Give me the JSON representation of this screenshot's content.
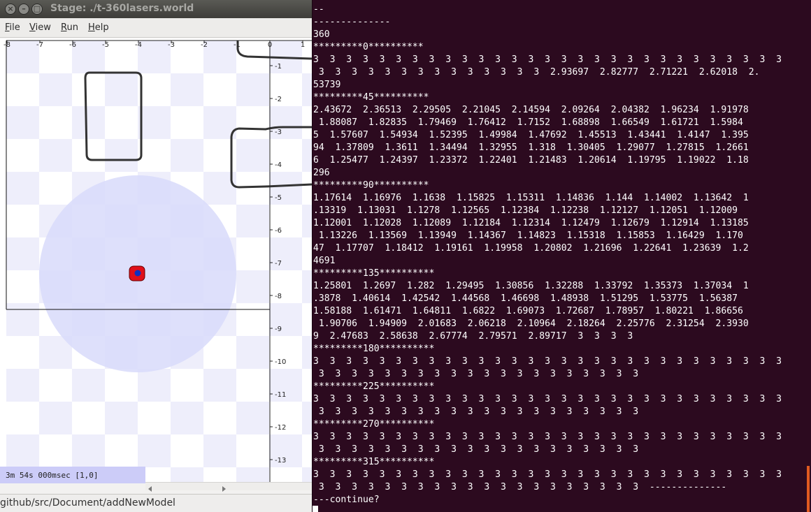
{
  "window": {
    "title": "Stage: ./t-360lasers.world",
    "close_glyph": "×",
    "minimize_glyph": "–",
    "maximize_glyph": "□"
  },
  "menu": [
    {
      "label": "File",
      "mnemonic": "F",
      "rest": "ile"
    },
    {
      "label": "View",
      "mnemonic": "V",
      "rest": "iew"
    },
    {
      "label": "Run",
      "mnemonic": "R",
      "rest": "un"
    },
    {
      "label": "Help",
      "mnemonic": "H",
      "rest": "elp"
    }
  ],
  "canvas": {
    "x_ticks": [
      "-8",
      "-7",
      "-6",
      "-5",
      "-4",
      "-3",
      "-2",
      "-1",
      "0",
      "1"
    ],
    "y_ticks": [
      "-1",
      "-2",
      "-3",
      "-4",
      "-5",
      "-6",
      "-7",
      "-8",
      "-9",
      "-10",
      "-11",
      "-12",
      "-13"
    ],
    "robot_color": "#e0101a",
    "robot_center_color": "#1030c0",
    "laser_range_color": "#d8dafa"
  },
  "status": {
    "text": "3m 54s 000msec [1,0]"
  },
  "nautilus": {
    "path": "github/src/Document/addNewModel"
  },
  "terminal": {
    "lines": [
      "--",
      "--------------",
      "360",
      "*********0**********",
      "3  3  3  3  3  3  3  3  3  3  3  3  3  3  3  3  3  3  3  3  3  3  3  3  3  3  3  3  3",
      " 3  3  3  3  3  3  3  3  3  3  3  3  3  3  2.93697  2.82777  2.71221  2.62018  2.",
      "53739",
      "*********45**********",
      "2.43672  2.36513  2.29505  2.21045  2.14594  2.09264  2.04382  1.96234  1.91978",
      " 1.88087  1.82835  1.79469  1.76412  1.7152  1.68898  1.66549  1.61721  1.5984",
      "5  1.57607  1.54934  1.52395  1.49984  1.47692  1.45513  1.43441  1.4147  1.395",
      "94  1.37809  1.3611  1.34494  1.32955  1.318  1.30405  1.29077  1.27815  1.2661",
      "6  1.25477  1.24397  1.23372  1.22401  1.21483  1.20614  1.19795  1.19022  1.18",
      "296",
      "*********90**********",
      "1.17614  1.16976  1.1638  1.15825  1.15311  1.14836  1.144  1.14002  1.13642  1",
      ".13319  1.13031  1.1278  1.12565  1.12384  1.12238  1.12127  1.12051  1.12009",
      "1.12001  1.12028  1.12089  1.12184  1.12314  1.12479  1.12679  1.12914  1.13185",
      " 1.13226  1.13569  1.13949  1.14367  1.14823  1.15318  1.15853  1.16429  1.170",
      "47  1.17707  1.18412  1.19161  1.19958  1.20802  1.21696  1.22641  1.23639  1.2",
      "4691",
      "*********135**********",
      "1.25801  1.2697  1.282  1.29495  1.30856  1.32288  1.33792  1.35373  1.37034  1",
      ".3878  1.40614  1.42542  1.44568  1.46698  1.48938  1.51295  1.53775  1.56387",
      "1.58188  1.61471  1.64811  1.6822  1.69073  1.72687  1.78957  1.80221  1.86656",
      " 1.90706  1.94909  2.01683  2.06218  2.10964  2.18264  2.25776  2.31254  2.3930",
      "9  2.47683  2.58638  2.67774  2.79571  2.89717  3  3  3  3",
      "*********180**********",
      "3  3  3  3  3  3  3  3  3  3  3  3  3  3  3  3  3  3  3  3  3  3  3  3  3  3  3  3  3",
      " 3  3  3  3  3  3  3  3  3  3  3  3  3  3  3  3  3  3  3  3",
      "*********225**********",
      "3  3  3  3  3  3  3  3  3  3  3  3  3  3  3  3  3  3  3  3  3  3  3  3  3  3  3  3  3",
      " 3  3  3  3  3  3  3  3  3  3  3  3  3  3  3  3  3  3  3  3",
      "*********270**********",
      "3  3  3  3  3  3  3  3  3  3  3  3  3  3  3  3  3  3  3  3  3  3  3  3  3  3  3  3  3",
      " 3  3  3  3  3  3  3  3  3  3  3  3  3  3  3  3  3  3  3  3",
      "*********315**********",
      "3  3  3  3  3  3  3  3  3  3  3  3  3  3  3  3  3  3  3  3  3  3  3  3  3  3  3  3  3",
      " 3  3  3  3  3  3  3  3  3  3  3  3  3  3  3  3  3  3  3  3  --------------",
      "---continue?"
    ]
  }
}
